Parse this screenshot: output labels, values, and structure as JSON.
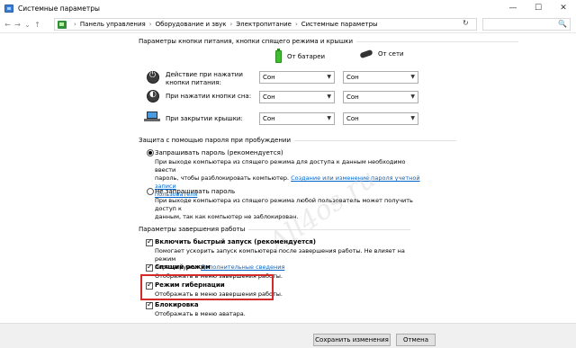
{
  "window": {
    "title": "Системные параметры",
    "controls": {
      "minimize": "—",
      "maximize": "☐",
      "close": "✕"
    }
  },
  "address": {
    "breadcrumbs": [
      "Панель управления",
      "Оборудование и звук",
      "Электропитание",
      "Системные параметры"
    ],
    "separator": "›",
    "refresh_glyph": "↻",
    "search_glyph": "🔍"
  },
  "power_buttons": {
    "heading": "Параметры кнопки питания, кнопки спящего режима и крышки",
    "col_battery": "От батареи",
    "col_ac": "От сети",
    "rows": [
      {
        "label": "Действие при нажатии кнопки питания:",
        "battery": "Сон",
        "ac": "Сон",
        "icon": "power-icon"
      },
      {
        "label": "При нажатии кнопки сна:",
        "battery": "Сон",
        "ac": "Сон",
        "icon": "sleep-icon"
      },
      {
        "label": "При закрытии крышки:",
        "battery": "Сон",
        "ac": "Сон",
        "icon": "laptop-icon"
      }
    ]
  },
  "password": {
    "heading": "Защита с помощью пароля при пробуждении",
    "option1_label": "Запрашивать пароль (рекомендуется)",
    "option1_desc_1": "При выходе компьютера из спящего режима для доступа к данным необходимо ввести",
    "option1_desc_2": "пароль, чтобы разблокировать компьютер.",
    "option1_link_1": "Создание или изменение пароля учетной записи",
    "option1_link_2": "пользователя",
    "option2_label": "Не запрашивать пароль",
    "option2_desc_1": "При выходе компьютера из спящего режима любой пользователь может получить доступ к",
    "option2_desc_2": "данным, так как компьютер не заблокирован."
  },
  "shutdown": {
    "heading": "Параметры завершения работы",
    "items": [
      {
        "label": "Включить быстрый запуск (рекомендуется)",
        "desc_1": "Помогает ускорить запуск компьютера после завершения работы. Не влияет на режим",
        "desc_2": "перезагрузки.",
        "link": "Дополнительные сведения",
        "checked": true
      },
      {
        "label": "Спящий режим",
        "desc_1": "Отображать в меню завершения работы.",
        "checked": true
      },
      {
        "label": "Режим гибернации",
        "desc_1": "Отображать в меню завершения работы.",
        "checked": true
      },
      {
        "label": "Блокировка",
        "desc_1": "Отображать в меню аватара.",
        "checked": true
      }
    ]
  },
  "watermark": "All4os.ru",
  "footer": {
    "save": "Сохранить изменения",
    "cancel": "Отмена"
  },
  "colors": {
    "highlight": "#d42a2a",
    "link": "#0066cc",
    "battery": "#3fbf2f"
  }
}
